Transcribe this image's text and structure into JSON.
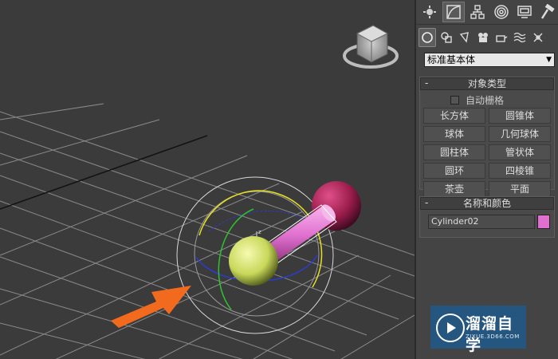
{
  "command_panel": {
    "main_tabs": [
      {
        "icon": "create-sun-icon",
        "active": false
      },
      {
        "icon": "modify-curve-icon",
        "active": true
      },
      {
        "icon": "hierarchy-icon",
        "active": false
      },
      {
        "icon": "motion-icon",
        "active": false
      },
      {
        "icon": "display-icon",
        "active": false
      },
      {
        "icon": "utilities-hammer-icon",
        "active": false
      }
    ],
    "sub_tabs": [
      {
        "icon": "geometry-icon",
        "active": true
      },
      {
        "icon": "shapes-icon",
        "active": false
      },
      {
        "icon": "lights-icon",
        "active": false
      },
      {
        "icon": "cameras-icon",
        "active": false
      },
      {
        "icon": "helpers-icon",
        "active": false
      },
      {
        "icon": "space-warps-icon",
        "active": false
      },
      {
        "icon": "systems-icon",
        "active": false
      }
    ],
    "category": "标准基本体",
    "object_type": {
      "title": "对象类型",
      "collapse": "-",
      "auto_grid": "自动栅格",
      "buttons": [
        "长方体",
        "圆锥体",
        "球体",
        "几何球体",
        "圆柱体",
        "管状体",
        "圆环",
        "四棱锥",
        "茶壶",
        "平面"
      ]
    },
    "name_color": {
      "title": "名称和颜色",
      "collapse": "-",
      "object_name": "Cylinder02",
      "color": "#e070d0"
    }
  },
  "viewport": {
    "gizmo_axis_label": "z",
    "sphere1_color": "#d8e86a",
    "sphere2_color": "#b0285a",
    "cylinder_color": "#e070d0",
    "arrow_color": "#f26a1e"
  },
  "watermark": {
    "title": "溜溜自学",
    "subtitle": "ZIXUE.3D66.COM"
  }
}
